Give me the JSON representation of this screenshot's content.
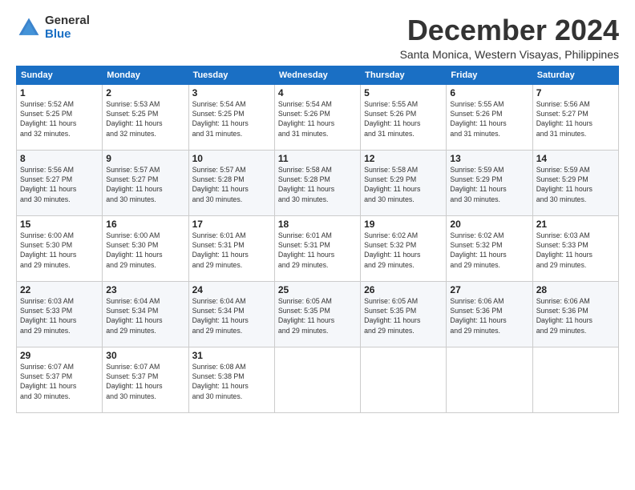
{
  "header": {
    "logo_general": "General",
    "logo_blue": "Blue",
    "month_title": "December 2024",
    "location": "Santa Monica, Western Visayas, Philippines"
  },
  "weekdays": [
    "Sunday",
    "Monday",
    "Tuesday",
    "Wednesday",
    "Thursday",
    "Friday",
    "Saturday"
  ],
  "weeks": [
    [
      {
        "day": "1",
        "info": "Sunrise: 5:52 AM\nSunset: 5:25 PM\nDaylight: 11 hours\nand 32 minutes."
      },
      {
        "day": "2",
        "info": "Sunrise: 5:53 AM\nSunset: 5:25 PM\nDaylight: 11 hours\nand 32 minutes."
      },
      {
        "day": "3",
        "info": "Sunrise: 5:54 AM\nSunset: 5:25 PM\nDaylight: 11 hours\nand 31 minutes."
      },
      {
        "day": "4",
        "info": "Sunrise: 5:54 AM\nSunset: 5:26 PM\nDaylight: 11 hours\nand 31 minutes."
      },
      {
        "day": "5",
        "info": "Sunrise: 5:55 AM\nSunset: 5:26 PM\nDaylight: 11 hours\nand 31 minutes."
      },
      {
        "day": "6",
        "info": "Sunrise: 5:55 AM\nSunset: 5:26 PM\nDaylight: 11 hours\nand 31 minutes."
      },
      {
        "day": "7",
        "info": "Sunrise: 5:56 AM\nSunset: 5:27 PM\nDaylight: 11 hours\nand 31 minutes."
      }
    ],
    [
      {
        "day": "8",
        "info": "Sunrise: 5:56 AM\nSunset: 5:27 PM\nDaylight: 11 hours\nand 30 minutes."
      },
      {
        "day": "9",
        "info": "Sunrise: 5:57 AM\nSunset: 5:27 PM\nDaylight: 11 hours\nand 30 minutes."
      },
      {
        "day": "10",
        "info": "Sunrise: 5:57 AM\nSunset: 5:28 PM\nDaylight: 11 hours\nand 30 minutes."
      },
      {
        "day": "11",
        "info": "Sunrise: 5:58 AM\nSunset: 5:28 PM\nDaylight: 11 hours\nand 30 minutes."
      },
      {
        "day": "12",
        "info": "Sunrise: 5:58 AM\nSunset: 5:29 PM\nDaylight: 11 hours\nand 30 minutes."
      },
      {
        "day": "13",
        "info": "Sunrise: 5:59 AM\nSunset: 5:29 PM\nDaylight: 11 hours\nand 30 minutes."
      },
      {
        "day": "14",
        "info": "Sunrise: 5:59 AM\nSunset: 5:29 PM\nDaylight: 11 hours\nand 30 minutes."
      }
    ],
    [
      {
        "day": "15",
        "info": "Sunrise: 6:00 AM\nSunset: 5:30 PM\nDaylight: 11 hours\nand 29 minutes."
      },
      {
        "day": "16",
        "info": "Sunrise: 6:00 AM\nSunset: 5:30 PM\nDaylight: 11 hours\nand 29 minutes."
      },
      {
        "day": "17",
        "info": "Sunrise: 6:01 AM\nSunset: 5:31 PM\nDaylight: 11 hours\nand 29 minutes."
      },
      {
        "day": "18",
        "info": "Sunrise: 6:01 AM\nSunset: 5:31 PM\nDaylight: 11 hours\nand 29 minutes."
      },
      {
        "day": "19",
        "info": "Sunrise: 6:02 AM\nSunset: 5:32 PM\nDaylight: 11 hours\nand 29 minutes."
      },
      {
        "day": "20",
        "info": "Sunrise: 6:02 AM\nSunset: 5:32 PM\nDaylight: 11 hours\nand 29 minutes."
      },
      {
        "day": "21",
        "info": "Sunrise: 6:03 AM\nSunset: 5:33 PM\nDaylight: 11 hours\nand 29 minutes."
      }
    ],
    [
      {
        "day": "22",
        "info": "Sunrise: 6:03 AM\nSunset: 5:33 PM\nDaylight: 11 hours\nand 29 minutes."
      },
      {
        "day": "23",
        "info": "Sunrise: 6:04 AM\nSunset: 5:34 PM\nDaylight: 11 hours\nand 29 minutes."
      },
      {
        "day": "24",
        "info": "Sunrise: 6:04 AM\nSunset: 5:34 PM\nDaylight: 11 hours\nand 29 minutes."
      },
      {
        "day": "25",
        "info": "Sunrise: 6:05 AM\nSunset: 5:35 PM\nDaylight: 11 hours\nand 29 minutes."
      },
      {
        "day": "26",
        "info": "Sunrise: 6:05 AM\nSunset: 5:35 PM\nDaylight: 11 hours\nand 29 minutes."
      },
      {
        "day": "27",
        "info": "Sunrise: 6:06 AM\nSunset: 5:36 PM\nDaylight: 11 hours\nand 29 minutes."
      },
      {
        "day": "28",
        "info": "Sunrise: 6:06 AM\nSunset: 5:36 PM\nDaylight: 11 hours\nand 29 minutes."
      }
    ],
    [
      {
        "day": "29",
        "info": "Sunrise: 6:07 AM\nSunset: 5:37 PM\nDaylight: 11 hours\nand 30 minutes."
      },
      {
        "day": "30",
        "info": "Sunrise: 6:07 AM\nSunset: 5:37 PM\nDaylight: 11 hours\nand 30 minutes."
      },
      {
        "day": "31",
        "info": "Sunrise: 6:08 AM\nSunset: 5:38 PM\nDaylight: 11 hours\nand 30 minutes."
      },
      {
        "day": "",
        "info": ""
      },
      {
        "day": "",
        "info": ""
      },
      {
        "day": "",
        "info": ""
      },
      {
        "day": "",
        "info": ""
      }
    ]
  ]
}
